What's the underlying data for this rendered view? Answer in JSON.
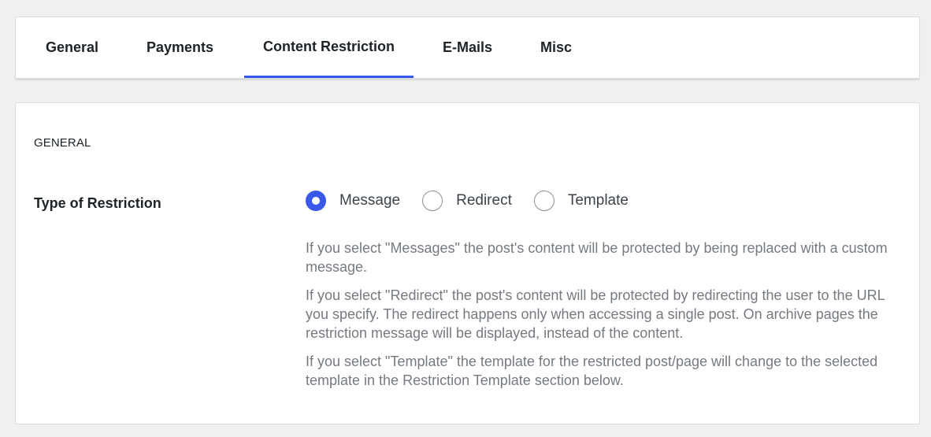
{
  "tabs": [
    {
      "label": "General",
      "active": false
    },
    {
      "label": "Payments",
      "active": false
    },
    {
      "label": "Content Restriction",
      "active": true
    },
    {
      "label": "E-Mails",
      "active": false
    },
    {
      "label": "Misc",
      "active": false
    }
  ],
  "panel": {
    "section_title": "GENERAL",
    "field_label": "Type of Restriction",
    "options": [
      {
        "label": "Message",
        "checked": true
      },
      {
        "label": "Redirect",
        "checked": false
      },
      {
        "label": "Template",
        "checked": false
      }
    ],
    "descriptions": [
      "If you select \"Messages\" the post's content will be protected by being replaced with a custom message.",
      "If you select \"Redirect\" the post's content will be protected by redirecting the user to the URL you specify. The redirect happens only when accessing a single post. On archive pages the restriction message will be displayed, instead of the content.",
      "If you select \"Template\" the template for the restricted post/page will change to the selected template in the Restriction Template section below."
    ]
  },
  "colors": {
    "accent": "#3858e9",
    "background": "#f0f0f1",
    "card": "#ffffff",
    "description_text": "#757a80"
  }
}
